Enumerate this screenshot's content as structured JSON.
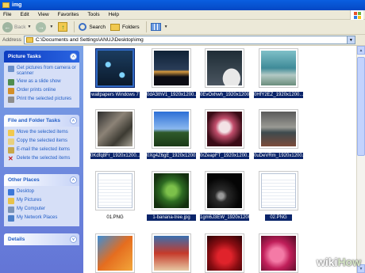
{
  "window": {
    "title": "img"
  },
  "menu": [
    "File",
    "Edit",
    "View",
    "Favorites",
    "Tools",
    "Help"
  ],
  "toolbar": {
    "back": "Back",
    "search": "Search",
    "folders": "Folders"
  },
  "address": {
    "label": "Address",
    "path": "C:\\Documents and Settings\\ANUJ\\Desktop\\img"
  },
  "picture_tasks": {
    "title": "Picture Tasks",
    "items": [
      "Get pictures from camera or scanner",
      "View as a slide show",
      "Order prints online",
      "Print the selected pictures"
    ]
  },
  "file_tasks": {
    "title": "File and Folder Tasks",
    "items": [
      "Move the selected items",
      "Copy the selected items",
      "E-mail the selected items",
      "Delete the selected items"
    ]
  },
  "other_places": {
    "title": "Other Places",
    "items": [
      "Desktop",
      "My Pictures",
      "My Computer",
      "My Network Places"
    ]
  },
  "details": {
    "title": "Details"
  },
  "files": [
    {
      "name": "wallpapers Windows 7"
    },
    {
      "name": "0dA3thV1_1920x1200..."
    },
    {
      "name": "0EvOxhwh_1920x1200..."
    },
    {
      "name": "0HfY2EZ_1920x1200..."
    },
    {
      "name": "0Kdfq8Fr_1920x1200..."
    },
    {
      "name": "0Xg4Z6gE_1920x1200..."
    },
    {
      "name": "0rZeapFT_1920x1200..."
    },
    {
      "name": "0uDeVRm_1920x1200..."
    },
    {
      "name": "01.PNG"
    },
    {
      "name": "1-banana-tree.jpg"
    },
    {
      "name": "1gm6J3EW_1920x1200..."
    },
    {
      "name": "02.PNG"
    }
  ],
  "watermark": {
    "wiki": "wiki",
    "how": "How"
  },
  "colors": {
    "selection": "#0a246a",
    "titlebar": "#0548c4",
    "taskpane": "#6e8fe0"
  }
}
